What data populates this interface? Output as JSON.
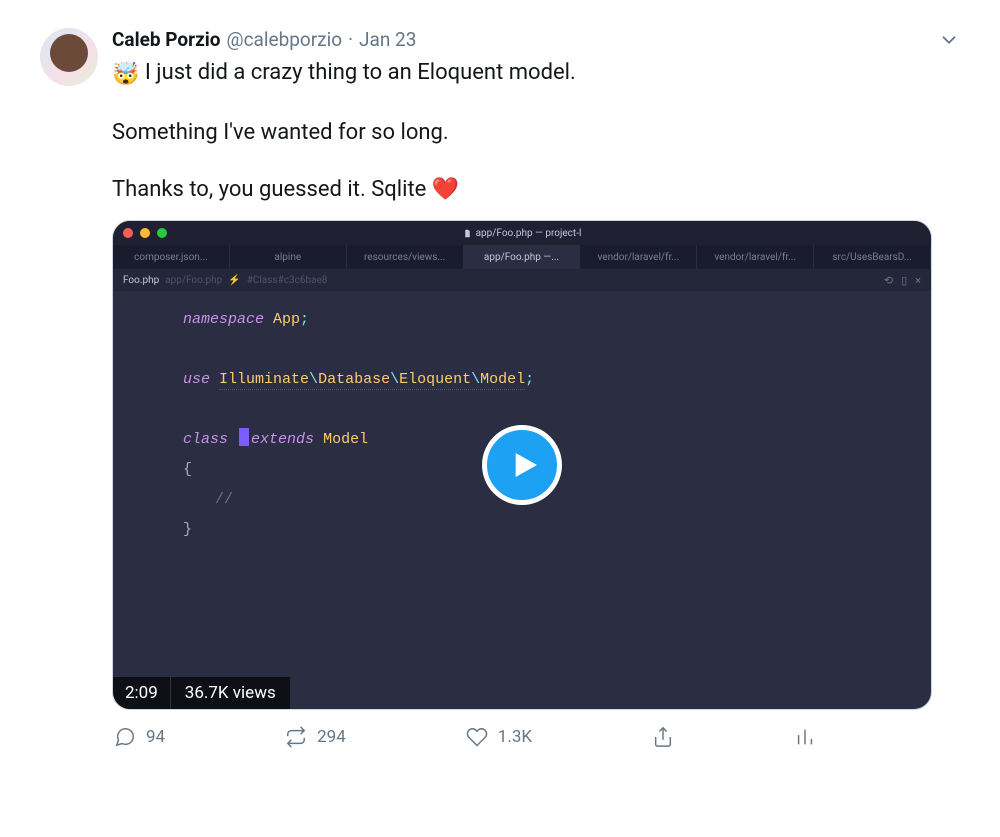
{
  "author": {
    "display_name": "Caleb Porzio",
    "handle": "@calebporzio",
    "date": "Jan 23"
  },
  "text": {
    "emoji": "🤯",
    "line1": " I just did a crazy thing to an Eloquent model.",
    "line2": "Something I've wanted for so long.",
    "line3_prefix": "Thanks to, you guessed it. Sqlite ",
    "heart": "❤️"
  },
  "editor": {
    "window_title": "app/Foo.php — project-l",
    "tabs": [
      "composer.json...",
      "alpine",
      "resources/views...",
      "app/Foo.php —...",
      "vendor/laravel/fr...",
      "vendor/laravel/fr...",
      "src/UsesBearsD..."
    ],
    "active_tab_index": 3,
    "crumb_file": "Foo.php",
    "crumb_path": "app/Foo.php",
    "crumb_hash": "#Class#c3c6bae8",
    "code": {
      "ns_kw": "namespace",
      "ns_name": "App",
      "use_kw": "use",
      "use_path": [
        "Illuminate",
        "Database",
        "Eloquent",
        "Model"
      ],
      "class_kw": "class",
      "extends_kw": "extends",
      "extends_name": "Model",
      "comment": "//"
    }
  },
  "video": {
    "duration": "2:09",
    "views": "36.7K views"
  },
  "metrics": {
    "replies": "94",
    "retweets": "294",
    "likes": "1.3K"
  }
}
